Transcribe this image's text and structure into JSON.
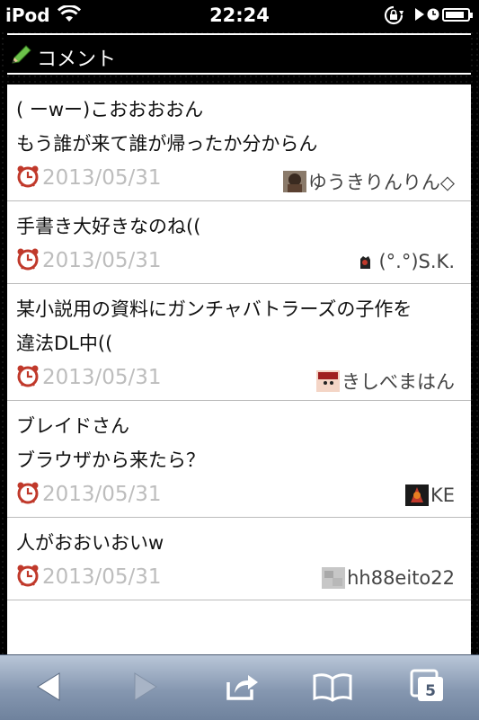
{
  "status_bar": {
    "carrier": "iPod",
    "time": "22:24",
    "battery_level": 0.85
  },
  "header": {
    "title": "コメント",
    "icon": "pencil-icon"
  },
  "comments": [
    {
      "text": "( ーwー)こおおおおん\nもう誰が来て誰が帰ったか分からん",
      "date": "2013/05/31",
      "user": "ゆうきりんりん◇"
    },
    {
      "text": "手書き大好きなのね((",
      "date": "2013/05/31",
      "user": "(°.°)S.K."
    },
    {
      "text": "某小説用の資料にガンチャバトラーズの子作を\n違法DL中((",
      "date": "2013/05/31",
      "user": "きしべまはん"
    },
    {
      "text": "ブレイドさん\nブラウザから来たら？",
      "date": "2013/05/31",
      "user": "KE"
    },
    {
      "text": "人がおおいおいw",
      "date": "2013/05/31",
      "user": "hh88eito22"
    }
  ],
  "toolbar": {
    "tabs_count": "5",
    "buttons": [
      "back-icon",
      "forward-icon",
      "share-icon",
      "bookmarks-icon",
      "tabs-icon"
    ]
  },
  "colors": {
    "background": "#000000",
    "list_background": "#ffffff",
    "date_text": "#bdbdbd",
    "toolbar_top": "#b9c6d8",
    "toolbar_bottom": "#6f829d",
    "alarm_red": "#c0392b"
  }
}
